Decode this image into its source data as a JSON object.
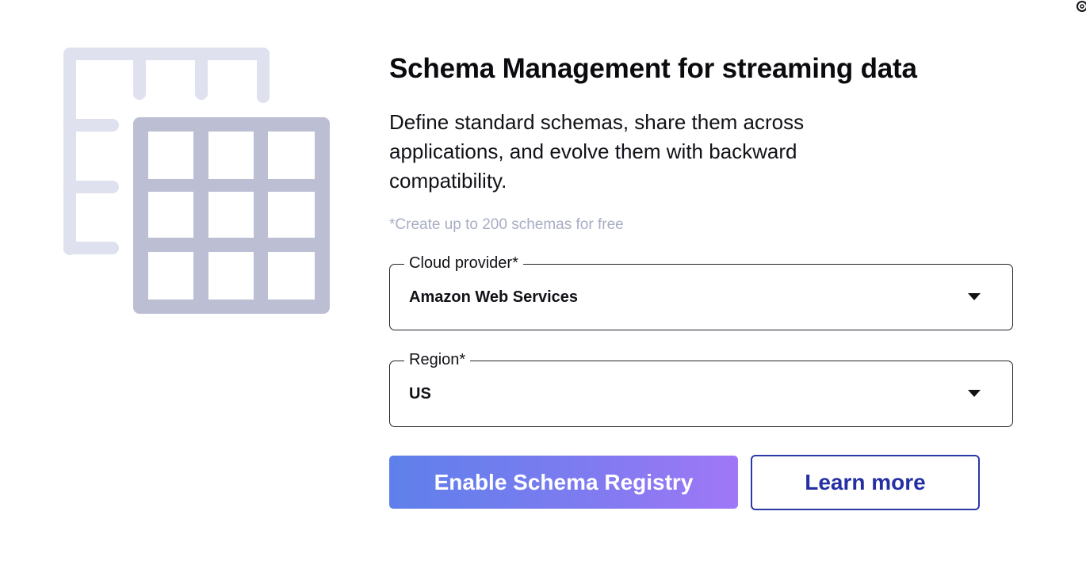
{
  "hero": {
    "icon": "schema-table-icon",
    "title": "Schema Management for streaming data",
    "description": "Define standard schemas, share them across applications, and evolve them with backward compatibility.",
    "note": "*Create up to 200 schemas for free"
  },
  "form": {
    "cloud_provider": {
      "label": "Cloud provider*",
      "value": "Amazon Web Services"
    },
    "region": {
      "label": "Region*",
      "value": "US"
    }
  },
  "actions": {
    "enable_label": "Enable Schema Registry",
    "learn_more_label": "Learn more"
  },
  "colors": {
    "accent_gradient_start": "#5e80ea",
    "accent_gradient_end": "#a077f6",
    "secondary_border": "#2a38a8",
    "note_text": "#a9adc3",
    "illustration_back": "#dfe1ee",
    "illustration_front": "#bcbfd3"
  }
}
